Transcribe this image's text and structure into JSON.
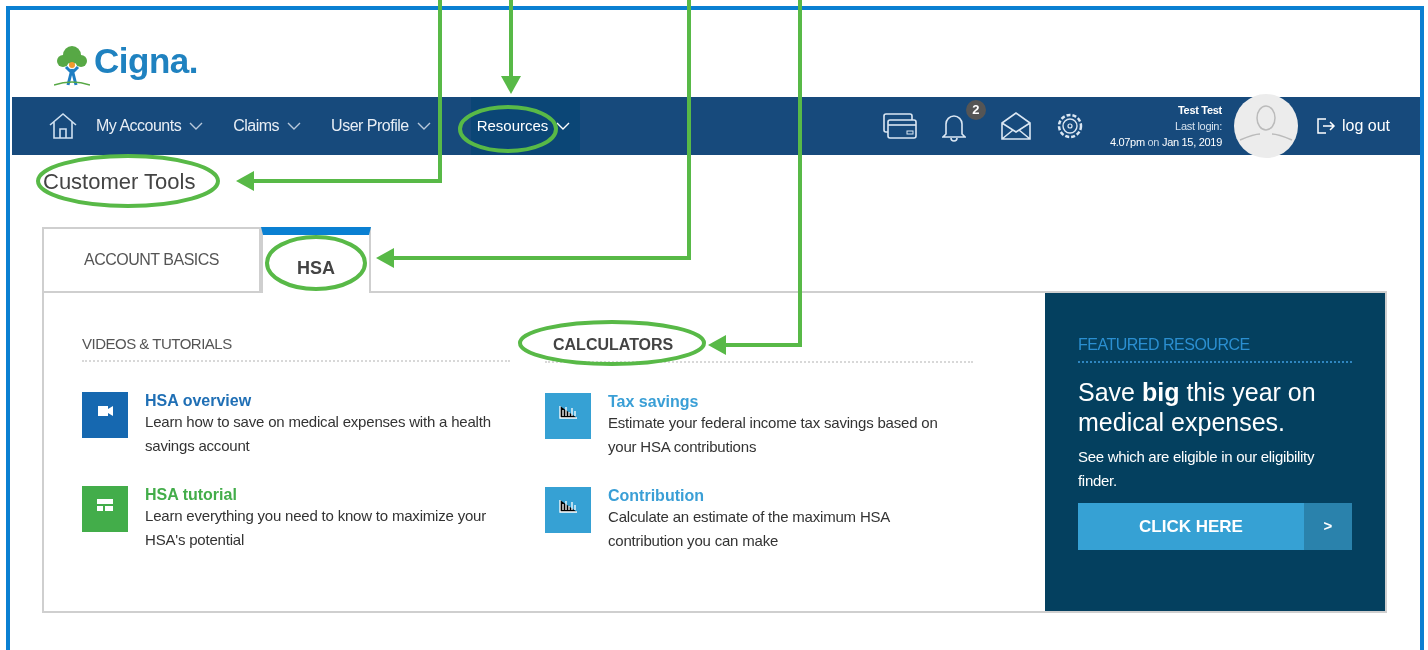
{
  "brand": {
    "name": "Cigna."
  },
  "nav": {
    "items": [
      {
        "label": "My Accounts",
        "selected": false
      },
      {
        "label": "Claims",
        "selected": false
      },
      {
        "label": "User Profile",
        "selected": false
      },
      {
        "label": "Resources",
        "selected": true
      }
    ],
    "notifications": "2",
    "user": {
      "name": "Test Test",
      "last_login_label": "Last login:",
      "last_login_time": "4.07pm",
      "last_login_on": "on",
      "last_login_date": "Jan 15, 2019"
    },
    "logout": "log out"
  },
  "page_title": "Customer Tools",
  "tabs": [
    {
      "label": "ACCOUNT BASICS",
      "selected": false
    },
    {
      "label": "HSA",
      "selected": true
    }
  ],
  "sections": [
    {
      "heading": "VIDEOS & TUTORIALS",
      "emphasis": false,
      "items": [
        {
          "kind": "video",
          "title": "HSA overview",
          "description": "Learn how to save on medical expenses with a health savings account"
        },
        {
          "kind": "tutorial",
          "title": "HSA tutorial",
          "description": "Learn everything you need to know to maximize your HSA's potential"
        }
      ]
    },
    {
      "heading": "CALCULATORS",
      "emphasis": true,
      "items": [
        {
          "kind": "calculator",
          "title": "Tax savings",
          "description": "Estimate your federal income tax savings based on your HSA contributions"
        },
        {
          "kind": "calculator",
          "title": "Contribution",
          "description": "Calculate an estimate of the maximum HSA contribution you can make"
        }
      ]
    }
  ],
  "featured": {
    "label": "FEATURED RESOURCE",
    "headline": "Save **big** this year on medical expenses.",
    "text": "See which are eligible in our eligibility finder.",
    "button": "CLICK HERE",
    "button_arrow": ">"
  }
}
